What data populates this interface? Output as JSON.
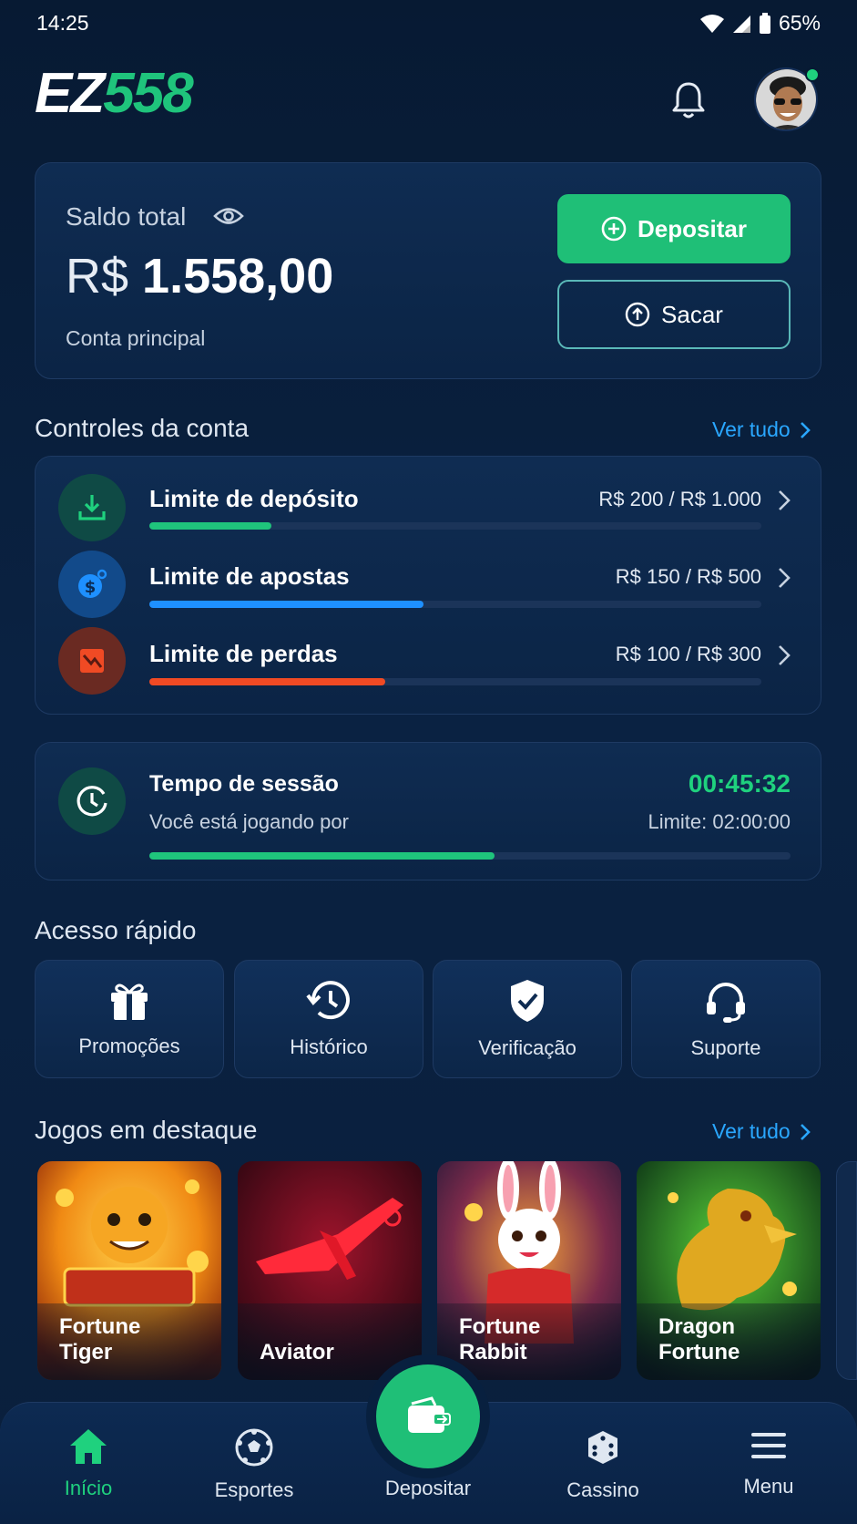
{
  "status_bar": {
    "time": "14:25",
    "battery": "65%"
  },
  "header": {
    "logo_ez": "EZ",
    "logo_num": "558"
  },
  "balance": {
    "label": "Saldo total",
    "currency": "R$",
    "amount": "1.558,00",
    "account": "Conta principal",
    "deposit_label": "Depositar",
    "withdraw_label": "Sacar"
  },
  "controls": {
    "title": "Controles da conta",
    "see_all": "Ver tudo",
    "items": [
      {
        "name": "Limite de depósito",
        "value": "R$ 200 / R$ 1.000",
        "progress": 0.2,
        "color": "#1fc47c",
        "icon": "deposit-limit-icon"
      },
      {
        "name": "Limite de apostas",
        "value": "R$ 150 / R$ 500",
        "progress": 0.448,
        "color": "#1e90ff",
        "icon": "bet-limit-icon"
      },
      {
        "name": "Limite de perdas",
        "value": "R$ 100 / R$ 300",
        "progress": 0.385,
        "color": "#f04a24",
        "icon": "loss-limit-icon"
      }
    ]
  },
  "session": {
    "title": "Tempo de sessão",
    "subtitle": "Você está jogando por",
    "time": "00:45:32",
    "limit": "Limite: 02:00:00",
    "progress": 0.538
  },
  "quick_access": {
    "title": "Acesso rápido",
    "items": [
      {
        "label": "Promoções",
        "icon": "gift-icon"
      },
      {
        "label": "Histórico",
        "icon": "history-icon"
      },
      {
        "label": "Verificação",
        "icon": "shield-check-icon"
      },
      {
        "label": "Suporte",
        "icon": "headset-icon"
      }
    ]
  },
  "games": {
    "title": "Jogos em destaque",
    "see_all": "Ver tudo",
    "items": [
      {
        "name": "Fortune\nTiger",
        "color_a": "#f7a21b",
        "color_b": "#b3300d"
      },
      {
        "name": "Aviator",
        "color_a": "#b0122a",
        "color_b": "#3a0812"
      },
      {
        "name": "Fortune\nRabbit",
        "color_a": "#e23a2d",
        "color_b": "#5a1820"
      },
      {
        "name": "Dragon\nFortune",
        "color_a": "#3fbf3a",
        "color_b": "#0c3a18"
      }
    ]
  },
  "nav": {
    "items": [
      {
        "label": "Início",
        "icon": "home-icon",
        "active": true
      },
      {
        "label": "Esportes",
        "icon": "soccer-ball-icon",
        "active": false
      },
      {
        "label": "Depositar",
        "icon": "wallet-icon",
        "active": false
      },
      {
        "label": "Cassino",
        "icon": "dice-icon",
        "active": false
      },
      {
        "label": "Menu",
        "icon": "menu-icon",
        "active": false
      }
    ]
  }
}
